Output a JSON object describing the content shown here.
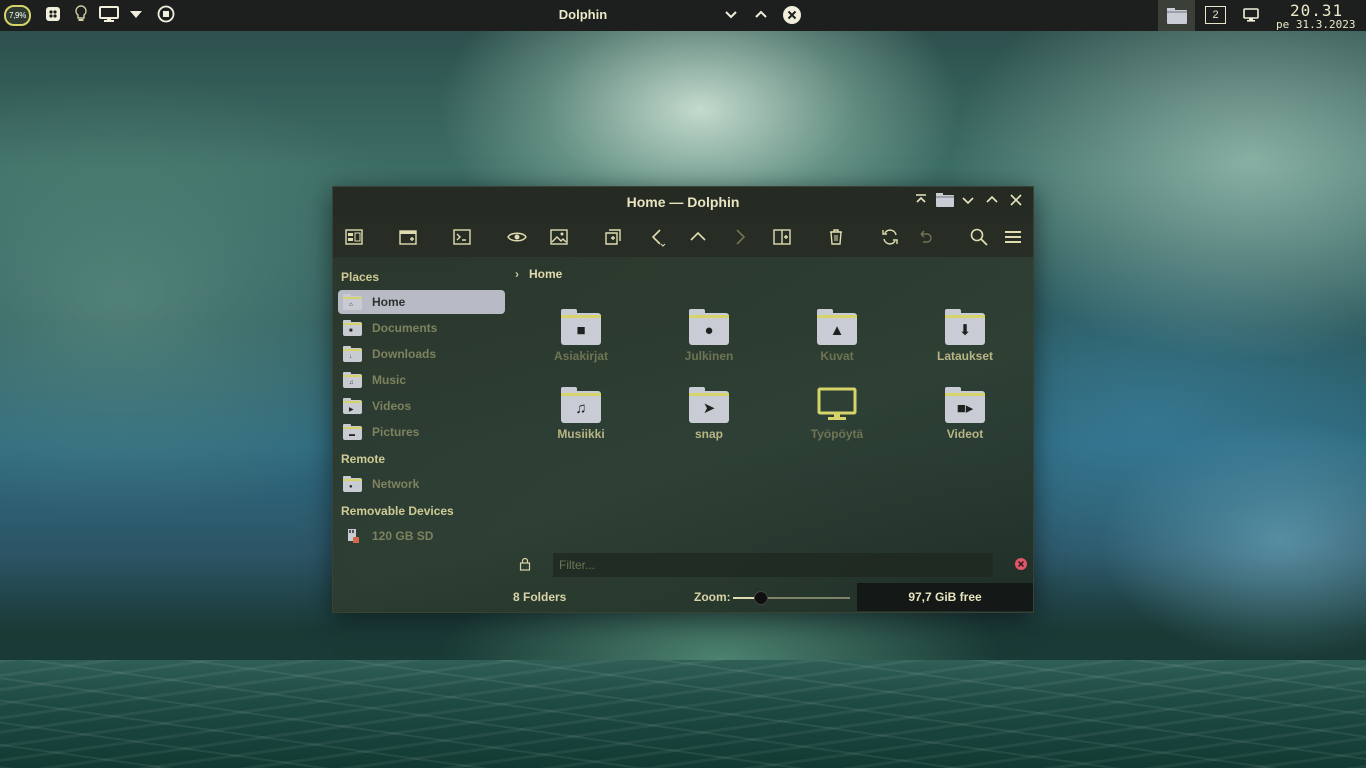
{
  "panel": {
    "battery": "7,9%",
    "title": "Dolphin",
    "pager_number": "2",
    "clock_time": "20.31",
    "clock_date": "pe 31.3.2023"
  },
  "window": {
    "title": "Home — Dolphin"
  },
  "sidebar": {
    "places_title": "Places",
    "places": [
      {
        "label": "Home",
        "icon": "home-icon"
      },
      {
        "label": "Documents",
        "icon": "documents-icon"
      },
      {
        "label": "Downloads",
        "icon": "downloads-icon"
      },
      {
        "label": "Music",
        "icon": "music-icon"
      },
      {
        "label": "Videos",
        "icon": "videos-icon"
      },
      {
        "label": "Pictures",
        "icon": "pictures-icon"
      }
    ],
    "remote_title": "Remote",
    "remote": [
      {
        "label": "Network",
        "icon": "network-icon"
      }
    ],
    "removable_title": "Removable Devices",
    "removable": [
      {
        "label": "120 GB SD",
        "icon": "sd-card-icon"
      }
    ]
  },
  "main": {
    "breadcrumb": "Home",
    "items": [
      {
        "label": "Asiakirjat",
        "icon": "document-folder-icon"
      },
      {
        "label": "Julkinen",
        "icon": "public-folder-icon"
      },
      {
        "label": "Kuvat",
        "icon": "pictures-folder-icon"
      },
      {
        "label": "Lataukset",
        "icon": "downloads-folder-icon"
      },
      {
        "label": "Musiikki",
        "icon": "music-folder-icon"
      },
      {
        "label": "snap",
        "icon": "snap-folder-icon"
      },
      {
        "label": "Työpöytä",
        "icon": "desktop-folder-icon"
      },
      {
        "label": "Videot",
        "icon": "videos-folder-icon"
      }
    ],
    "filter_placeholder": "Filter..."
  },
  "status": {
    "summary": "8 Folders",
    "zoom_label": "Zoom:",
    "zoom_level": 0.24,
    "free_space": "97,7 GiB free"
  },
  "colors": {
    "accent": "#d6d36a",
    "text": "#d8d4a8",
    "panel_bg": "#1c1f1d",
    "selection": "#b8bbc6"
  }
}
